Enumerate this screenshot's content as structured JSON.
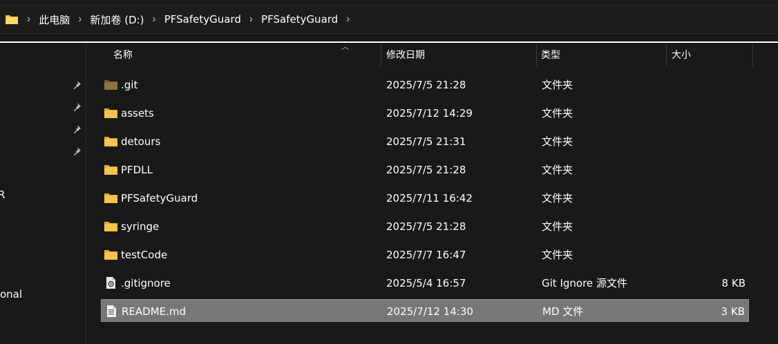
{
  "breadcrumb": {
    "items": [
      {
        "label": "此电脑"
      },
      {
        "label": "新加卷 (D:)"
      },
      {
        "label": "PFSafetyGuard"
      },
      {
        "label": "PFSafetyGuard"
      }
    ]
  },
  "sidebar": {
    "fragments": [
      "R",
      "onal"
    ],
    "pins": 4
  },
  "columns": {
    "name": "名称",
    "date": "修改日期",
    "type": "类型",
    "size": "大小"
  },
  "files": [
    {
      "icon": "folder-dim-icon",
      "name": ".git",
      "date": "2025/7/5 21:28",
      "type": "文件夹",
      "size": ""
    },
    {
      "icon": "folder-icon",
      "name": "assets",
      "date": "2025/7/12 14:29",
      "type": "文件夹",
      "size": ""
    },
    {
      "icon": "folder-icon",
      "name": "detours",
      "date": "2025/7/5 21:31",
      "type": "文件夹",
      "size": ""
    },
    {
      "icon": "folder-icon",
      "name": "PFDLL",
      "date": "2025/7/5 21:28",
      "type": "文件夹",
      "size": ""
    },
    {
      "icon": "folder-icon",
      "name": "PFSafetyGuard",
      "date": "2025/7/11 16:42",
      "type": "文件夹",
      "size": ""
    },
    {
      "icon": "folder-icon",
      "name": "syringe",
      "date": "2025/7/5 21:28",
      "type": "文件夹",
      "size": ""
    },
    {
      "icon": "folder-icon",
      "name": "testCode",
      "date": "2025/7/7 16:47",
      "type": "文件夹",
      "size": ""
    },
    {
      "icon": "config-file-icon",
      "name": ".gitignore",
      "date": "2025/5/4 16:57",
      "type": "Git Ignore 源文件",
      "size": "8 KB"
    },
    {
      "icon": "text-file-icon",
      "name": "README.md",
      "date": "2025/7/12 14:30",
      "type": "MD 文件",
      "size": "3 KB",
      "selected": true
    }
  ],
  "colors": {
    "background": "#191919",
    "folder": "#f4c44e",
    "folder_dim": "#8a7440",
    "selected_row": "#777777"
  }
}
